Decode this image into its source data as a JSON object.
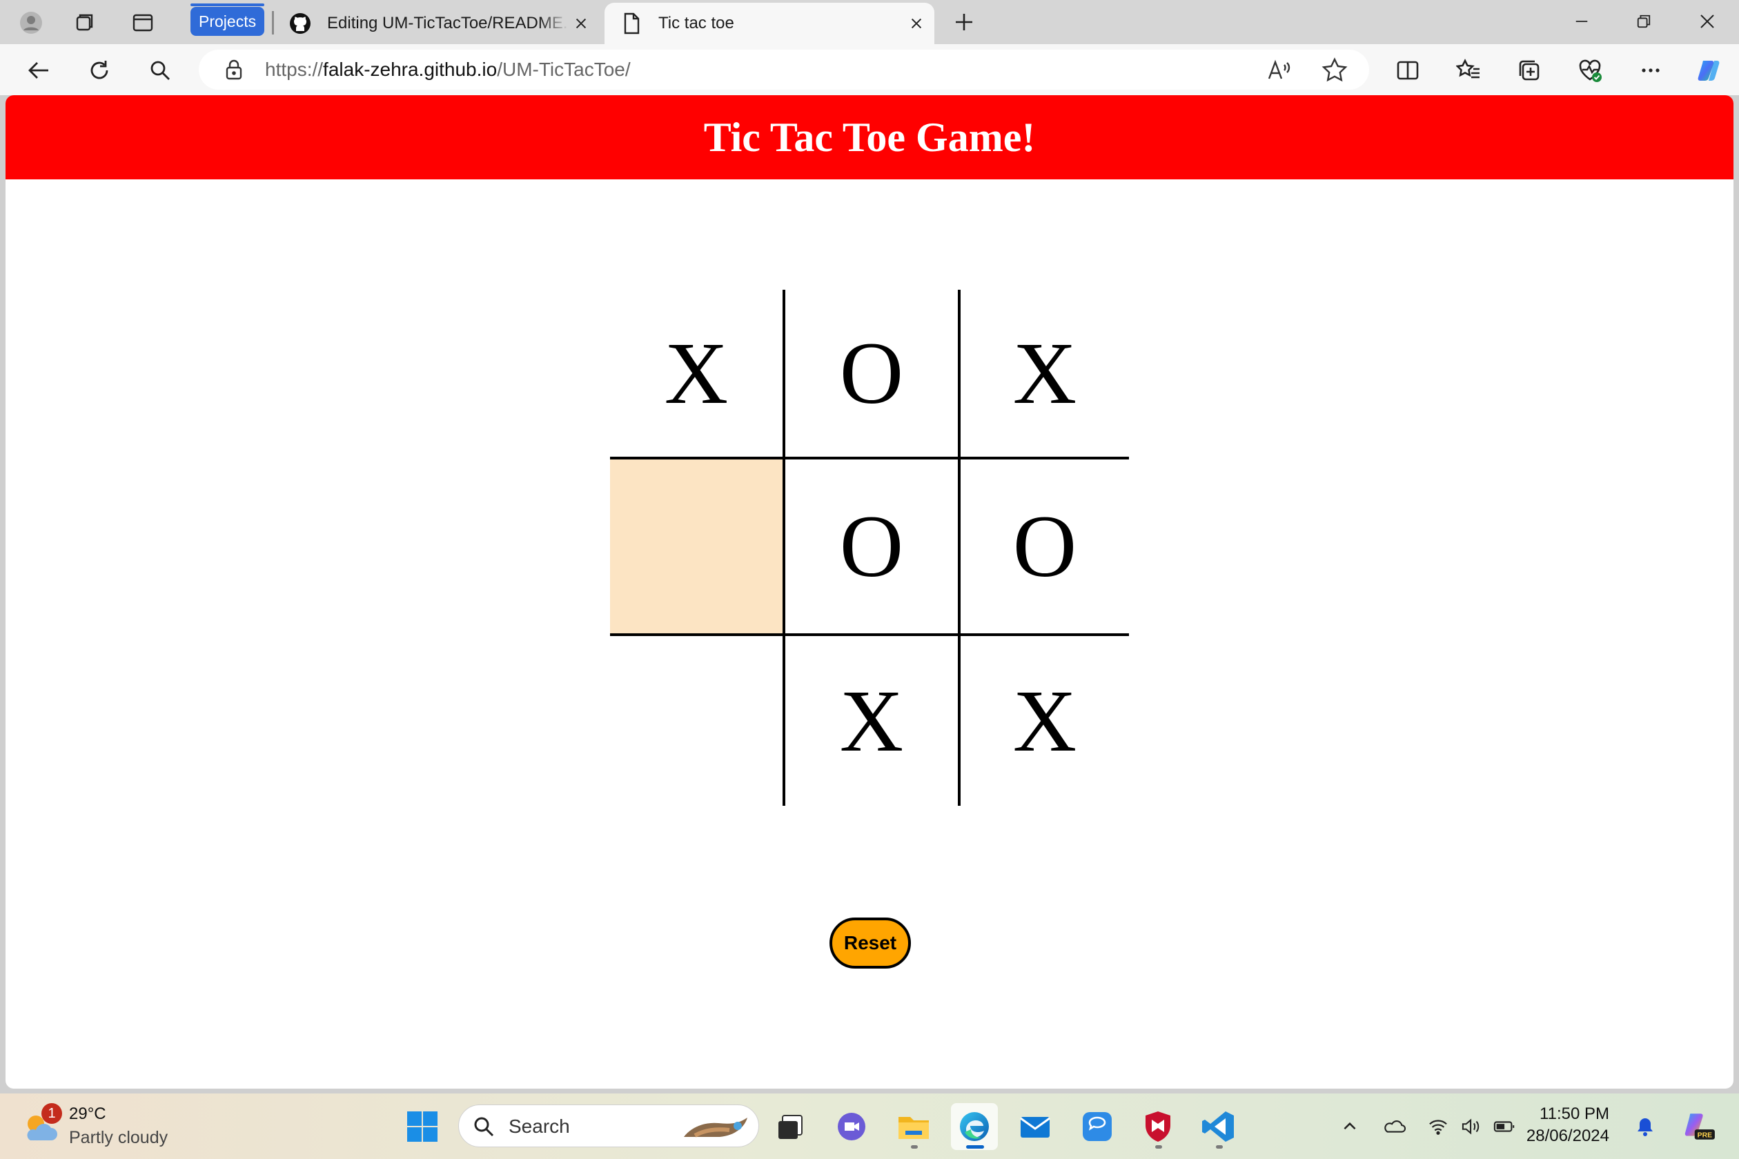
{
  "browser": {
    "tab_group_label": "Projects",
    "tabs": [
      {
        "title": "Editing UM-TicTacToe/README.md",
        "active": false
      },
      {
        "title": "Tic tac toe",
        "active": true
      }
    ],
    "url_scheme": "https://",
    "url_host": "falak-zehra.github.io",
    "url_path": "/UM-TicTacToe/"
  },
  "page": {
    "heading": "Tic Tac Toe Game!",
    "board": [
      {
        "mark": "X",
        "highlighted": false
      },
      {
        "mark": "O",
        "highlighted": false
      },
      {
        "mark": "X",
        "highlighted": false
      },
      {
        "mark": "",
        "highlighted": true
      },
      {
        "mark": "O",
        "highlighted": false
      },
      {
        "mark": "O",
        "highlighted": false
      },
      {
        "mark": "",
        "highlighted": false
      },
      {
        "mark": "X",
        "highlighted": false
      },
      {
        "mark": "X",
        "highlighted": false
      }
    ],
    "reset_label": "Reset",
    "colors": {
      "header_bg": "#ff0000",
      "highlight_cell": "#fce4c3",
      "reset_bg": "#ffa500"
    }
  },
  "taskbar": {
    "weather_badge": "1",
    "weather_temp": "29°C",
    "weather_condition": "Partly cloudy",
    "search_placeholder": "Search",
    "time": "11:50 PM",
    "date": "28/06/2024",
    "apps": [
      "start-icon",
      "task-view-icon",
      "teams-icon",
      "file-explorer-icon",
      "edge-icon",
      "mail-icon",
      "chat-icon",
      "mcafee-icon",
      "vscode-icon"
    ]
  }
}
